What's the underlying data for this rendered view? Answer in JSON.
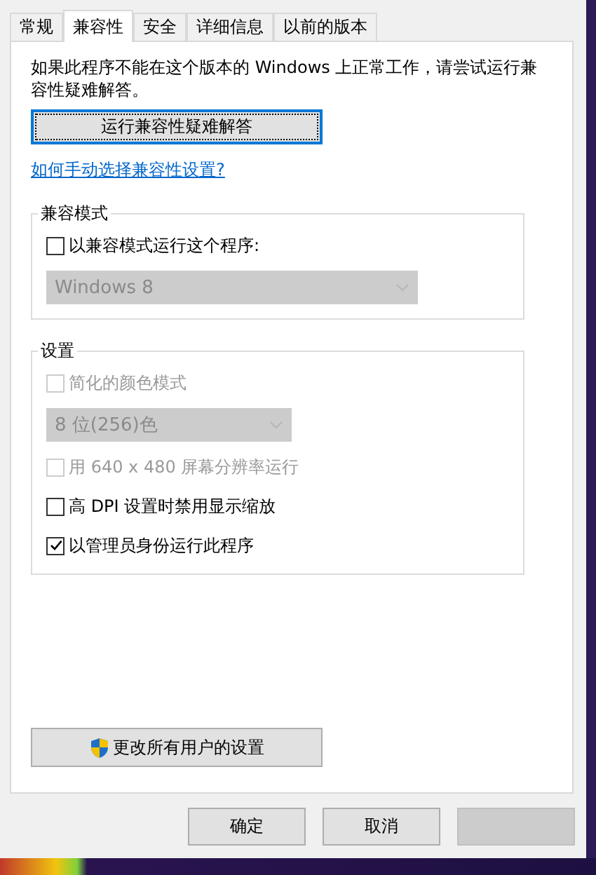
{
  "tabs": [
    {
      "label": "常规",
      "selected": false
    },
    {
      "label": "兼容性",
      "selected": true
    },
    {
      "label": "安全",
      "selected": false
    },
    {
      "label": "详细信息",
      "selected": false
    },
    {
      "label": "以前的版本",
      "selected": false
    }
  ],
  "intro": "如果此程序不能在这个版本的 Windows 上正常工作，请尝试运行兼容性疑难解答。",
  "troubleshoot_button": "运行兼容性疑难解答",
  "help_link": "如何手动选择兼容性设置?",
  "groups": [
    {
      "title": "兼容模式",
      "items": [
        {
          "kind": "checkbox",
          "label": "以兼容模式运行这个程序:",
          "checked": false,
          "disabled": false
        },
        {
          "kind": "dropdown",
          "value": "Windows 8",
          "disabled": true
        }
      ]
    },
    {
      "title": "设置",
      "items": [
        {
          "kind": "checkbox",
          "label": "简化的颜色模式",
          "checked": false,
          "disabled": true
        },
        {
          "kind": "dropdown",
          "value": "8 位(256)色",
          "disabled": true
        },
        {
          "kind": "checkbox",
          "label": "用 640 x 480 屏幕分辨率运行",
          "checked": false,
          "disabled": true
        },
        {
          "kind": "checkbox",
          "label": "高 DPI 设置时禁用显示缩放",
          "checked": false,
          "disabled": false
        },
        {
          "kind": "checkbox",
          "label": "以管理员身份运行此程序",
          "checked": true,
          "disabled": false
        }
      ]
    }
  ],
  "all_users_button": "更改所有用户的设置",
  "buttons": [
    {
      "label": "确定",
      "disabled": false
    },
    {
      "label": "取消",
      "disabled": false
    },
    {
      "disabled": true
    }
  ]
}
